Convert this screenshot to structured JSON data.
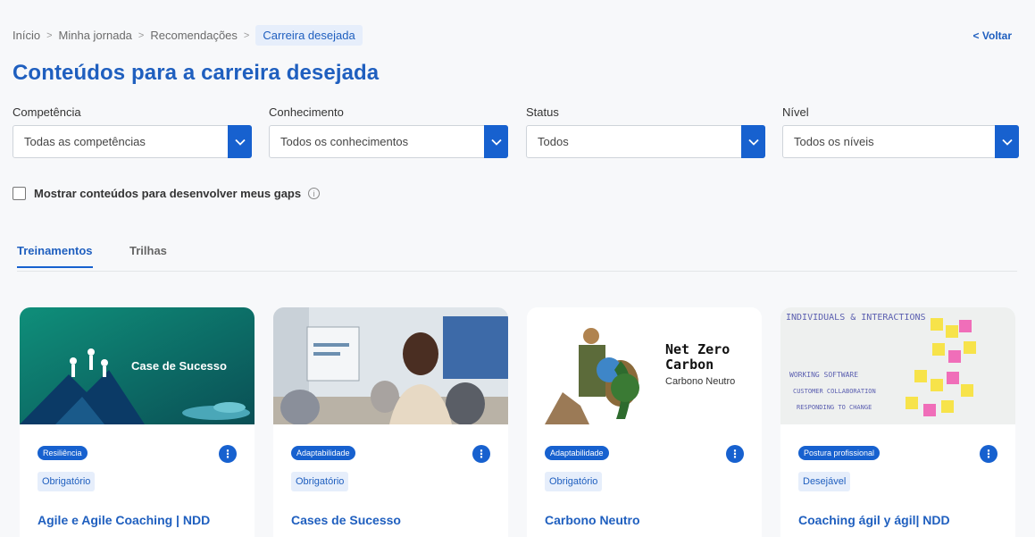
{
  "breadcrumb": {
    "items": [
      "Início",
      "Minha jornada",
      "Recomendações"
    ],
    "current": "Carreira desejada",
    "separator": ">"
  },
  "back_label": "< Voltar",
  "page_title": "Conteúdos para a carreira desejada",
  "filters": [
    {
      "label": "Competência",
      "value": "Todas as competências"
    },
    {
      "label": "Conhecimento",
      "value": "Todos os conhecimentos"
    },
    {
      "label": "Status",
      "value": "Todos"
    },
    {
      "label": "Nível",
      "value": "Todos os níveis"
    }
  ],
  "gaps_checkbox": {
    "label": "Mostrar conteúdos para desenvolver meus gaps",
    "checked": false,
    "info_icon": "i"
  },
  "tabs": [
    {
      "label": "Treinamentos",
      "active": true
    },
    {
      "label": "Trilhas",
      "active": false
    }
  ],
  "cards": [
    {
      "thumb_text": "Case de Sucesso",
      "tag": "Resiliência",
      "requirement": "Obrigatório",
      "title": "Agile e Agile Coaching | NDD"
    },
    {
      "thumb_text": "",
      "tag": "Adaptabilidade",
      "requirement": "Obrigatório",
      "title": "Cases de Sucesso"
    },
    {
      "thumb_text": "Net Zero Carbon",
      "thumb_sub": "Carbono Neutro",
      "tag": "Adaptabilidade",
      "requirement": "Obrigatório",
      "title": "Carbono Neutro"
    },
    {
      "thumb_text": "INDIVIDUALS & INTERACTIONS",
      "thumb_lines": [
        "WORKING SOFTWARE",
        "CUSTOMER COLLABORATION",
        "RESPONDING TO CHANGE"
      ],
      "tag": "Postura profissional",
      "requirement": "Desejável",
      "title": "Coaching ágil y ágil| NDD"
    }
  ],
  "colors": {
    "accent": "#1761cf",
    "title": "#1f5fbf",
    "chip_bg": "#e6eefb"
  }
}
